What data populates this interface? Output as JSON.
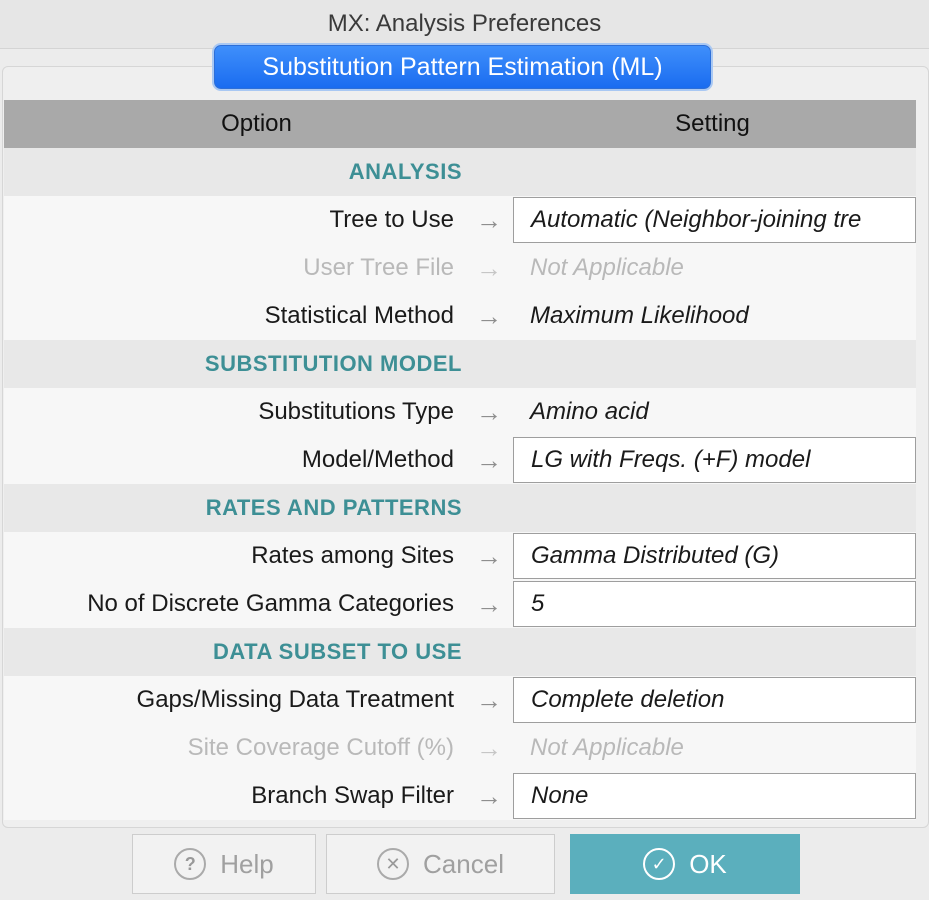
{
  "window": {
    "title": "MX: Analysis Preferences"
  },
  "tab": {
    "label": "Substitution Pattern Estimation (ML)"
  },
  "table": {
    "header": {
      "option": "Option",
      "setting": "Setting"
    },
    "arrow": "→",
    "rows": [
      {
        "type": "section",
        "label": "ANALYSIS"
      },
      {
        "type": "option",
        "option": "Tree to Use",
        "value": "Automatic (Neighbor-joining tre",
        "editable": true,
        "enabled": true
      },
      {
        "type": "option",
        "option": "User Tree File",
        "value": "Not Applicable",
        "editable": false,
        "enabled": false
      },
      {
        "type": "option",
        "option": "Statistical Method",
        "value": "Maximum Likelihood",
        "editable": false,
        "enabled": true
      },
      {
        "type": "section",
        "label": "SUBSTITUTION MODEL"
      },
      {
        "type": "option",
        "option": "Substitutions Type",
        "value": "Amino acid",
        "editable": false,
        "enabled": true
      },
      {
        "type": "option",
        "option": "Model/Method",
        "value": "LG with Freqs. (+F) model",
        "editable": true,
        "enabled": true
      },
      {
        "type": "section",
        "label": "RATES AND PATTERNS"
      },
      {
        "type": "option",
        "option": "Rates among Sites",
        "value": "Gamma Distributed (G)",
        "editable": true,
        "enabled": true
      },
      {
        "type": "option",
        "option": "No of Discrete Gamma Categories",
        "value": "5",
        "editable": true,
        "enabled": true
      },
      {
        "type": "section",
        "label": "DATA SUBSET TO USE"
      },
      {
        "type": "option",
        "option": "Gaps/Missing Data Treatment",
        "value": "Complete deletion",
        "editable": true,
        "enabled": true
      },
      {
        "type": "option",
        "option": "Site Coverage Cutoff (%)",
        "value": "Not Applicable",
        "editable": false,
        "enabled": false
      },
      {
        "type": "option",
        "option": "Branch Swap Filter",
        "value": "None",
        "editable": true,
        "enabled": true
      }
    ]
  },
  "buttons": {
    "help": {
      "label": "Help",
      "icon": "question-icon",
      "glyph": "?"
    },
    "cancel": {
      "label": "Cancel",
      "icon": "x-circle-icon",
      "glyph": "✕"
    },
    "ok": {
      "label": "OK",
      "icon": "check-circle-icon",
      "glyph": "✓"
    }
  },
  "colors": {
    "section_text": "#3d8f95",
    "ok_button": "#5bafbd",
    "tab_blue": "#1a6cf0"
  }
}
